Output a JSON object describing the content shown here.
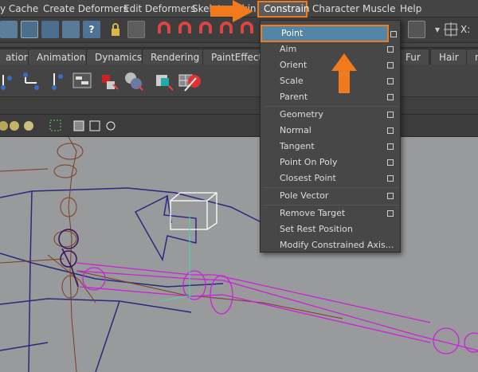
{
  "menubar": {
    "items": [
      "y Cache",
      "Create Deformers",
      "Edit Deformers",
      "Skeleton",
      "Skin",
      "Constrain",
      "Character",
      "Muscle",
      "Help"
    ]
  },
  "shelf_tabs": [
    "ation",
    "Animation",
    "Dynamics",
    "Rendering",
    "PaintEffects",
    "Fur",
    "Hair",
    "n"
  ],
  "toolbar": {
    "coord_label": "X:"
  },
  "constrain_menu": {
    "items": [
      {
        "label": "Point",
        "has_option": true,
        "highlighted": true
      },
      {
        "label": "Aim",
        "has_option": true
      },
      {
        "label": "Orient",
        "has_option": true
      },
      {
        "label": "Scale",
        "has_option": true
      },
      {
        "label": "Parent",
        "has_option": true
      },
      {
        "label": "Geometry",
        "has_option": true
      },
      {
        "label": "Normal",
        "has_option": true
      },
      {
        "label": "Tangent",
        "has_option": true
      },
      {
        "label": "Point On Poly",
        "has_option": true
      },
      {
        "label": "Closest Point",
        "has_option": true
      },
      {
        "label": "Pole Vector",
        "has_option": true
      },
      {
        "label": "Remove Target",
        "has_option": true
      },
      {
        "label": "Set Rest Position",
        "has_option": false
      },
      {
        "label": "Modify Constrained Axis...",
        "has_option": false
      }
    ]
  },
  "colors": {
    "accent": "#f07a1c",
    "highlight": "#5285a6",
    "viewport_bg": "#999a9b"
  }
}
